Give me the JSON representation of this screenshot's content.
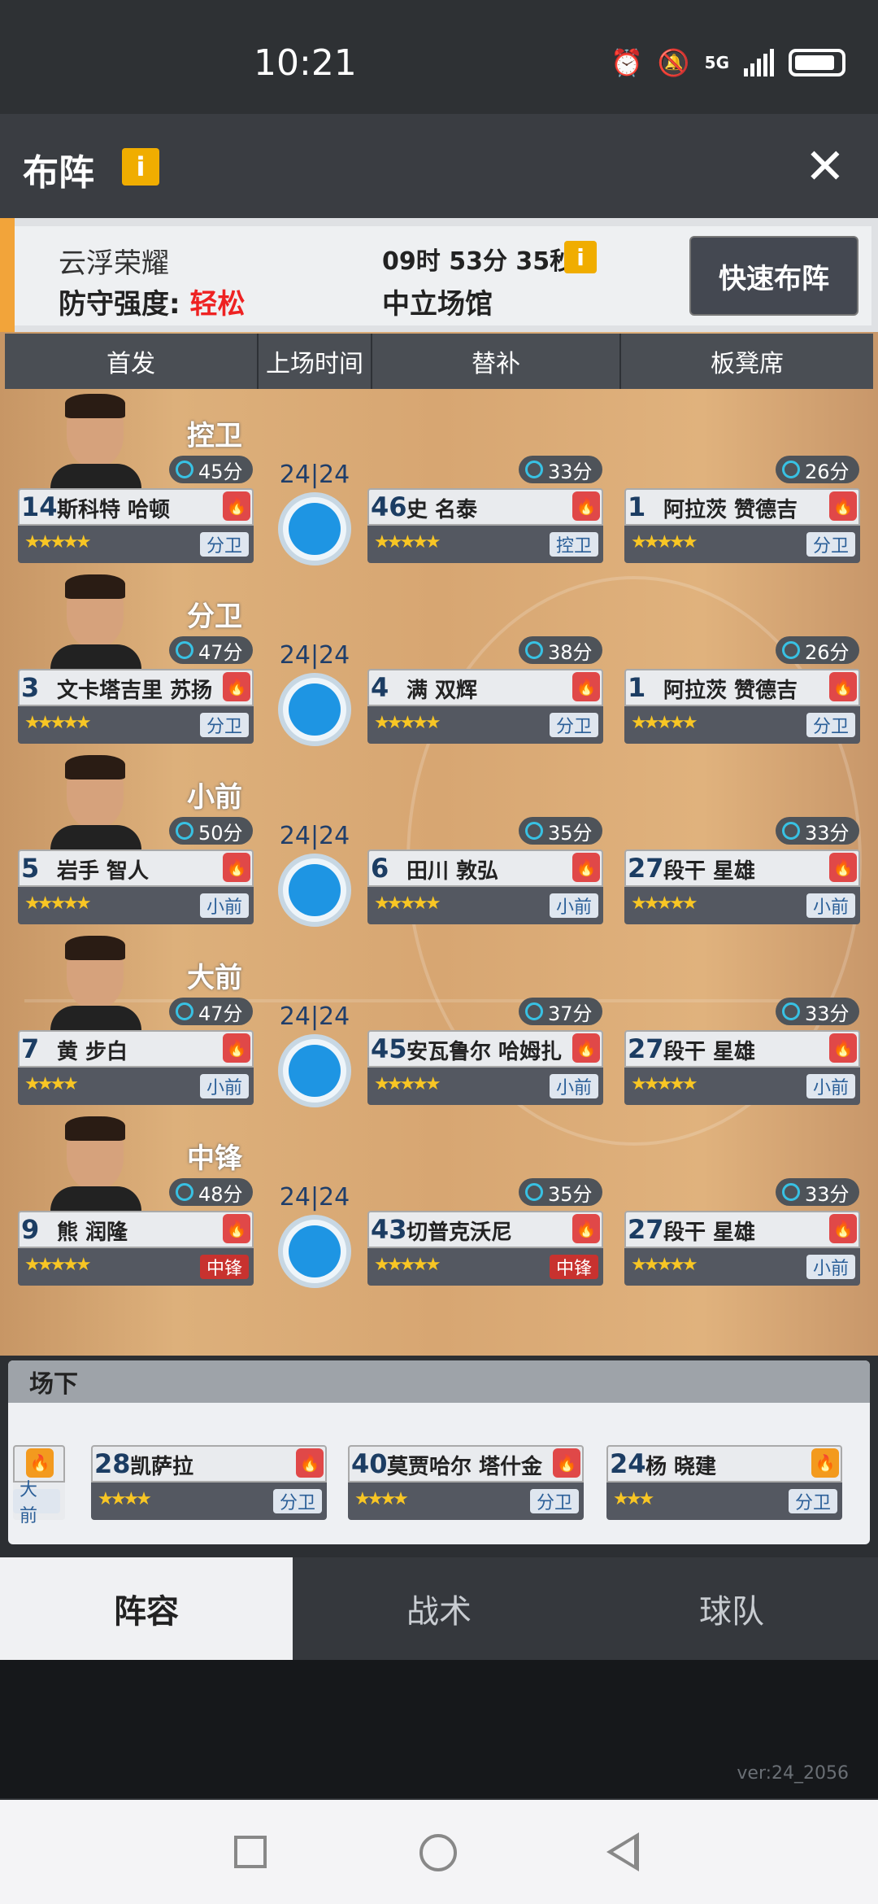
{
  "status": {
    "time": "10:21",
    "network": "5G"
  },
  "header": {
    "title": "布阵",
    "info": "i"
  },
  "panel": {
    "opponent": "云浮荣耀",
    "defense_label": "防守强度:",
    "defense_value": "轻松",
    "countdown": "09时 53分 35秒",
    "info": "i",
    "venue": "中立场馆",
    "quick_button": "快速布阵"
  },
  "columns": [
    "首发",
    "上场时间",
    "替补",
    "板凳席"
  ],
  "rows": [
    {
      "position": "控卫",
      "starter": {
        "num": "14",
        "name": "斯科特 哈顿",
        "mins": "45分",
        "pos": "分卫",
        "stars": "★★★★★",
        "red": false
      },
      "time": "24|24",
      "sub": {
        "num": "46",
        "name": "史 名泰",
        "mins": "33分",
        "pos": "控卫",
        "stars": "★★★★★",
        "red": false
      },
      "bench": {
        "num": "1",
        "name": "阿拉茨 赞德吉",
        "mins": "26分",
        "pos": "分卫",
        "stars": "★★★★★",
        "red": false
      }
    },
    {
      "position": "分卫",
      "starter": {
        "num": "3",
        "name": "文卡塔吉里 苏扬",
        "mins": "47分",
        "pos": "分卫",
        "stars": "★★★★★",
        "red": false
      },
      "time": "24|24",
      "sub": {
        "num": "4",
        "name": "满 双辉",
        "mins": "38分",
        "pos": "分卫",
        "stars": "★★★★★",
        "red": false
      },
      "bench": {
        "num": "1",
        "name": "阿拉茨 赞德吉",
        "mins": "26分",
        "pos": "分卫",
        "stars": "★★★★★",
        "red": false
      }
    },
    {
      "position": "小前",
      "starter": {
        "num": "5",
        "name": "岩手 智人",
        "mins": "50分",
        "pos": "小前",
        "stars": "★★★★★",
        "red": false
      },
      "time": "24|24",
      "sub": {
        "num": "6",
        "name": "田川 敦弘",
        "mins": "35分",
        "pos": "小前",
        "stars": "★★★★★",
        "red": false
      },
      "bench": {
        "num": "27",
        "name": "段干 星雄",
        "mins": "33分",
        "pos": "小前",
        "stars": "★★★★★",
        "red": false
      }
    },
    {
      "position": "大前",
      "starter": {
        "num": "7",
        "name": "黄 步白",
        "mins": "47分",
        "pos": "小前",
        "stars": "★★★★",
        "red": false
      },
      "time": "24|24",
      "sub": {
        "num": "45",
        "name": "安瓦鲁尔 哈姆扎",
        "mins": "37分",
        "pos": "小前",
        "stars": "★★★★★",
        "red": false
      },
      "bench": {
        "num": "27",
        "name": "段干 星雄",
        "mins": "33分",
        "pos": "小前",
        "stars": "★★★★★",
        "red": false
      }
    },
    {
      "position": "中锋",
      "starter": {
        "num": "9",
        "name": "熊 润隆",
        "mins": "48分",
        "pos": "中锋",
        "stars": "★★★★★",
        "red": true
      },
      "time": "24|24",
      "sub": {
        "num": "43",
        "name": "切普克沃尼",
        "mins": "35分",
        "pos": "中锋",
        "stars": "★★★★★",
        "red": true
      },
      "bench": {
        "num": "27",
        "name": "段干 星雄",
        "mins": "33分",
        "pos": "小前",
        "stars": "★★★★★",
        "red": false
      }
    }
  ],
  "bench_section": {
    "title": "场下",
    "partial": {
      "pos": "大前"
    },
    "players": [
      {
        "num": "28",
        "name": "凯萨拉",
        "pos": "分卫",
        "stars": "★★★★",
        "orange": false
      },
      {
        "num": "40",
        "name": "莫贾哈尔 塔什金",
        "pos": "分卫",
        "stars": "★★★★",
        "orange": false
      },
      {
        "num": "24",
        "name": "杨 晓建",
        "pos": "分卫",
        "stars": "★★★",
        "orange": true
      }
    ]
  },
  "tabs": [
    "阵容",
    "战术",
    "球队"
  ],
  "version": "ver:24_2056"
}
